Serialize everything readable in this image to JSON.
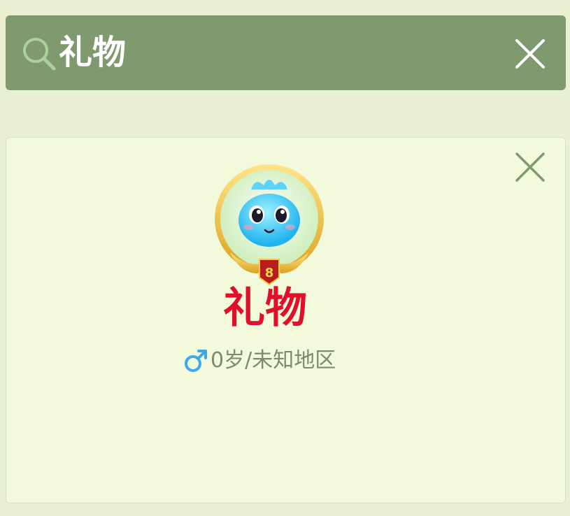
{
  "search": {
    "query": "礼物",
    "search_icon": "search-icon",
    "clear_icon": "close-icon"
  },
  "result_card": {
    "close_icon": "close-icon",
    "avatar": {
      "icon": "blue-blob-avatar",
      "level": "8"
    },
    "username": "礼物",
    "gender_icon": "male-icon",
    "info": "0岁/未知地区"
  },
  "colors": {
    "background": "#eaf1d2",
    "search_bar": "#7f9a6e",
    "card": "#f3fadb",
    "username": "#e0102a",
    "info_text": "#7d8a70",
    "male_icon": "#3fa8ea"
  }
}
